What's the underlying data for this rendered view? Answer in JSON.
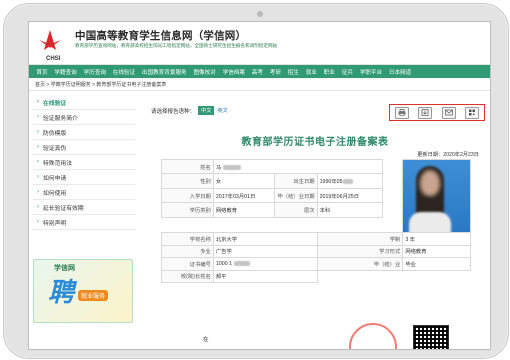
{
  "header": {
    "title": "中国高等教育学生信息网（学信网）",
    "logo_text": "CHSI",
    "subtitle_line1": "教育部学历查询网站，教育部高校招生阳光工程指定网站，全国硕士研究生招生报名和调剂指定网站",
    "subtitle_line2": ""
  },
  "nav": [
    "首页",
    "学籍查询",
    "学历查询",
    "在线验证",
    "出国教育背景服务",
    "图像校对",
    "学信档案",
    "高考",
    "考研",
    "招生",
    "就业",
    "职业",
    "征兵",
    "学职平台",
    "日本频道"
  ],
  "breadcrumb": "首页 > 学籍学历证明服务 > 教育部学历证书电子注册备案表",
  "sidebar": {
    "items": [
      "在线验证",
      "验证服务简介",
      "防伪模版",
      "验证真伪",
      "特殊范用法",
      "如何申请",
      "如何使用",
      "延长验证有效期",
      "特别声明"
    ],
    "ad_logo": "学信网",
    "ad_char": "聘",
    "ad_tag": "就业服务"
  },
  "main": {
    "lang_label": "请选择报告语种：",
    "lang_cn": "中文",
    "lang_en": "英文",
    "doc_title": "教育部学历证书电子注册备案表",
    "updated": "更新日期：2020年2月23日",
    "fields": {
      "name_label": "姓名",
      "name_value": "马",
      "gender_label": "性别",
      "gender_value": "女",
      "birth_label": "出生日期",
      "birth_value": "1990年05",
      "enroll_label": "入学日期",
      "enroll_value": "2017年03月01日",
      "grad_label": "毕（结）业日期",
      "grad_value": "2019年06月25日",
      "type_label": "学历类别",
      "type_value": "网络教育",
      "level_label": "层次",
      "level_value": "本科",
      "school_label": "学校名称",
      "school_value": "北京大学",
      "duration_label": "学制",
      "duration_value": "3 年",
      "major_label": "专业",
      "major_value": "广告学",
      "form_label": "学习形式",
      "form_value": "网络教育",
      "cert_label": "证书编号",
      "cert_value": "1000 1",
      "status_label": "毕（结）业",
      "status_value": "毕业",
      "principal_label": "校(院)长姓名",
      "principal_value": "郝平",
      "online_label": "在"
    },
    "tools": [
      "print-icon",
      "download-icon",
      "mail-icon",
      "qrcode-icon"
    ]
  },
  "colors": {
    "accent": "#2f9a74",
    "highlight": "#e0302a",
    "title": "#2f8a6c"
  }
}
